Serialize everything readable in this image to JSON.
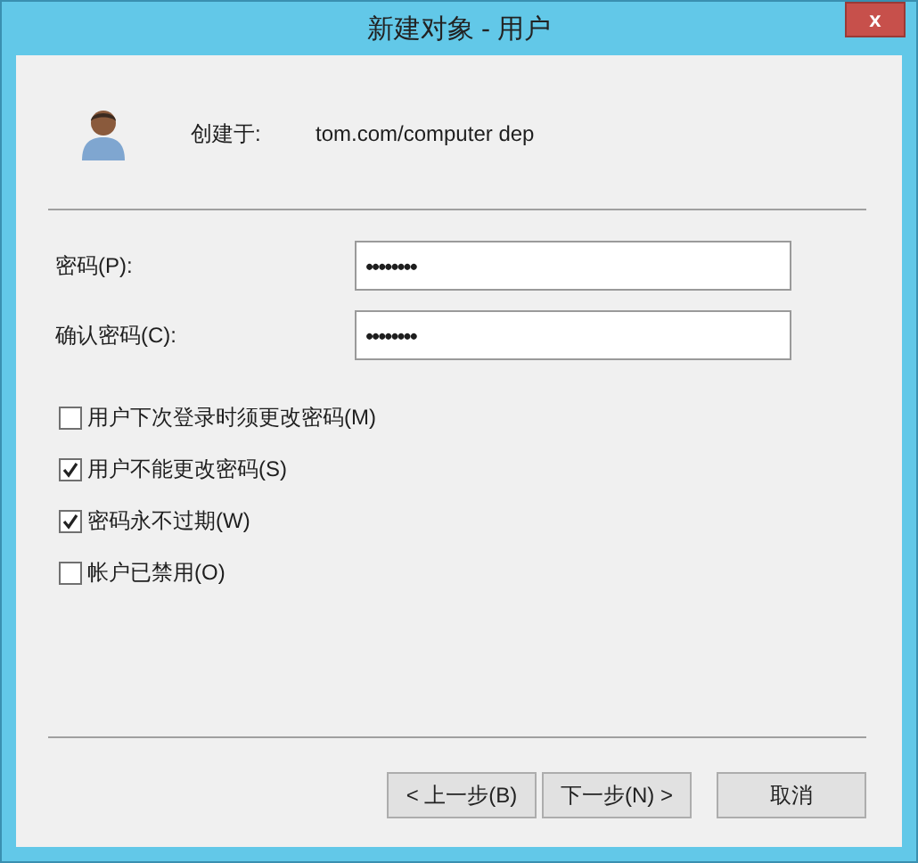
{
  "window": {
    "title": "新建对象 - 用户",
    "close": "x"
  },
  "created_in": {
    "label": "创建于:",
    "value": "tom.com/computer dep"
  },
  "fields": [
    {
      "label": "密码(P):",
      "value": "••••••••"
    },
    {
      "label": "确认密码(C):",
      "value": "••••••••"
    }
  ],
  "options": [
    {
      "label": "用户下次登录时须更改密码(M)",
      "checked": false
    },
    {
      "label": "用户不能更改密码(S)",
      "checked": true
    },
    {
      "label": "密码永不过期(W)",
      "checked": true
    },
    {
      "label": "帐户已禁用(O)",
      "checked": false
    }
  ],
  "buttons": [
    {
      "label": "< 上一步(B)",
      "kind": "nav"
    },
    {
      "label": "下一步(N) >",
      "kind": "nav"
    },
    {
      "label": "取消",
      "kind": "cancel"
    }
  ]
}
